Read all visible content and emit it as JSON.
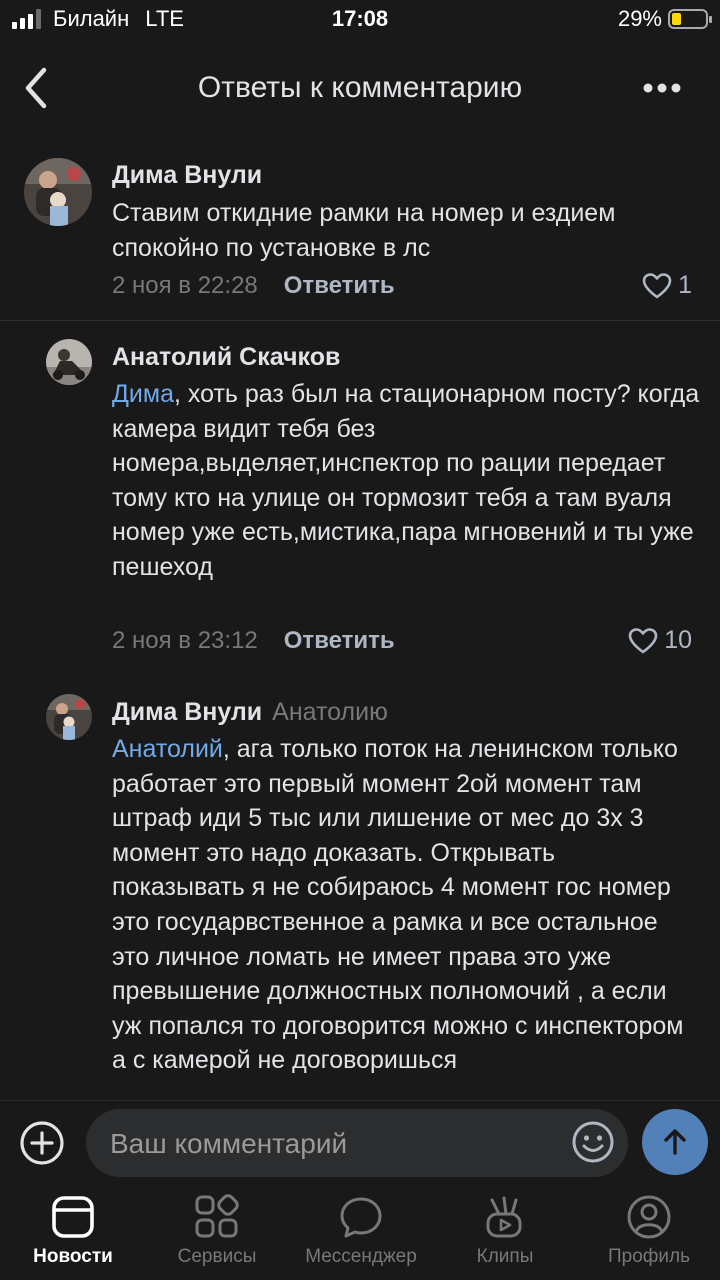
{
  "status_bar": {
    "carrier": "Билайн",
    "network": "LTE",
    "time": "17:08",
    "battery_percent": "29%",
    "battery_level": 0.29,
    "signal_bars": 3
  },
  "header": {
    "back_icon": "chevron-left-icon",
    "title": "Ответы к комментарию",
    "more_icon": "more-dots-icon"
  },
  "comments": [
    {
      "author": "Дима Внули",
      "reply_to": "",
      "mention": "",
      "text": "Ставим откидние рамки на номер и ездием спокойно по установке в лс",
      "date": "2 ноя в 22:28",
      "reply_label": "Ответить",
      "likes": "1"
    },
    {
      "author": "Анатолий Скачков",
      "reply_to": "",
      "mention": "Дима",
      "text": ", хоть раз был на стационарном посту? когда камера видит тебя без номера,выделяет,инспектор по рации передает тому кто на улице он тормозит тебя а там вуаля номер уже есть,мистика,пара мгновений и ты уже пешеход",
      "date": "2 ноя в 23:12",
      "reply_label": "Ответить",
      "likes": "10"
    },
    {
      "author": "Дима Внули",
      "reply_to": "Анатолию",
      "mention": "Анатолий",
      "text": ", ага только поток на ленинском только работает это первый момент 2ой момент там штраф иди 5 тыс или лишение от мес до 3х 3 момент это надо доказать. Открывать показывать я не собираюсь 4 момент гос номер это государвственное а рамка и все остальное это личное ломать не имеет права это уже превышение должностных полномочий , а если уж попался то договорится можно с инспектором а с камерой не договоришься"
    }
  ],
  "composer": {
    "placeholder": "Ваш комментарий",
    "add_icon": "plus-circle-icon",
    "emoji_icon": "smile-icon",
    "send_icon": "arrow-up-icon"
  },
  "tabbar": {
    "items": [
      {
        "label": "Новости",
        "icon": "news-icon",
        "active": true
      },
      {
        "label": "Сервисы",
        "icon": "services-icon",
        "active": false
      },
      {
        "label": "Мессенджер",
        "icon": "messenger-icon",
        "active": false
      },
      {
        "label": "Клипы",
        "icon": "clips-icon",
        "active": false
      },
      {
        "label": "Профиль",
        "icon": "profile-icon",
        "active": false
      }
    ]
  },
  "colors": {
    "background": "#191919",
    "text": "#e1e3e6",
    "secondary": "#76787a",
    "mention": "#71aaeb",
    "accent": "#5181b8"
  }
}
